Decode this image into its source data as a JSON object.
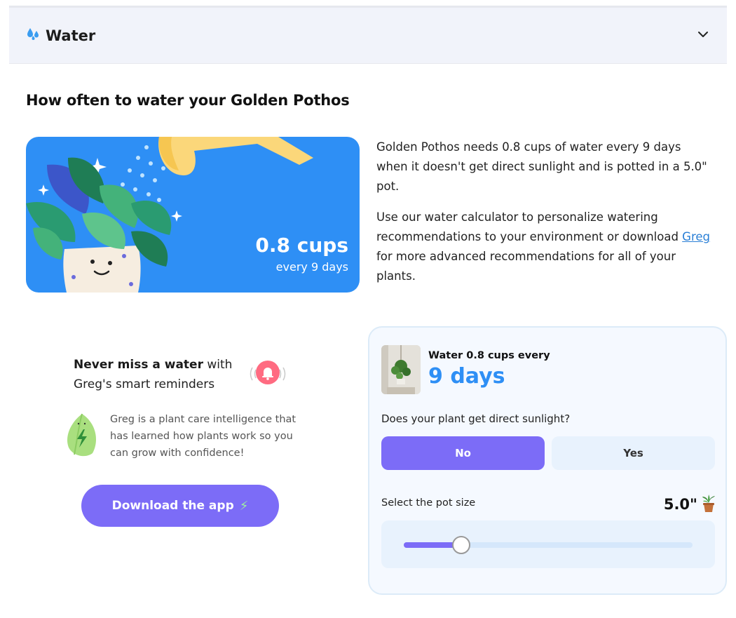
{
  "accordion": {
    "title": "Water",
    "icon": "water-drops-icon",
    "expand_icon": "chevron-down-icon"
  },
  "section": {
    "title": "How often to water your Golden Pothos"
  },
  "hero": {
    "amount": "0.8 cups",
    "frequency": "every 9 days",
    "colors": {
      "background": "#2e8ff5"
    }
  },
  "description": {
    "p1": "Golden Pothos needs 0.8 cups of water every 9 days when it doesn't get direct sunlight and is potted in a 5.0\" pot.",
    "p2_before": "Use our water calculator to personalize watering recommendations to your environment or download ",
    "p2_link": "Greg",
    "p2_after": " for more advanced recommendations for all of your plants."
  },
  "promo": {
    "title_bold": "Never miss a water",
    "title_rest": " with Greg's smart reminders",
    "body": "Greg is a plant care intelligence that has learned how plants work so you can grow with confidence!",
    "button_label": "Download the app",
    "button_icon": "⚡"
  },
  "calculator": {
    "water_line": "Water 0.8 cups every",
    "water_days": "9 days",
    "sunlight_question": "Does your plant get direct sunlight?",
    "options": [
      "No",
      "Yes"
    ],
    "selected_option": "No",
    "pot_label": "Select the pot size",
    "pot_value": "5.0\"",
    "slider_fraction": 0.2,
    "colors": {
      "accent": "#7c6cf7",
      "days": "#2e8ff5"
    }
  }
}
